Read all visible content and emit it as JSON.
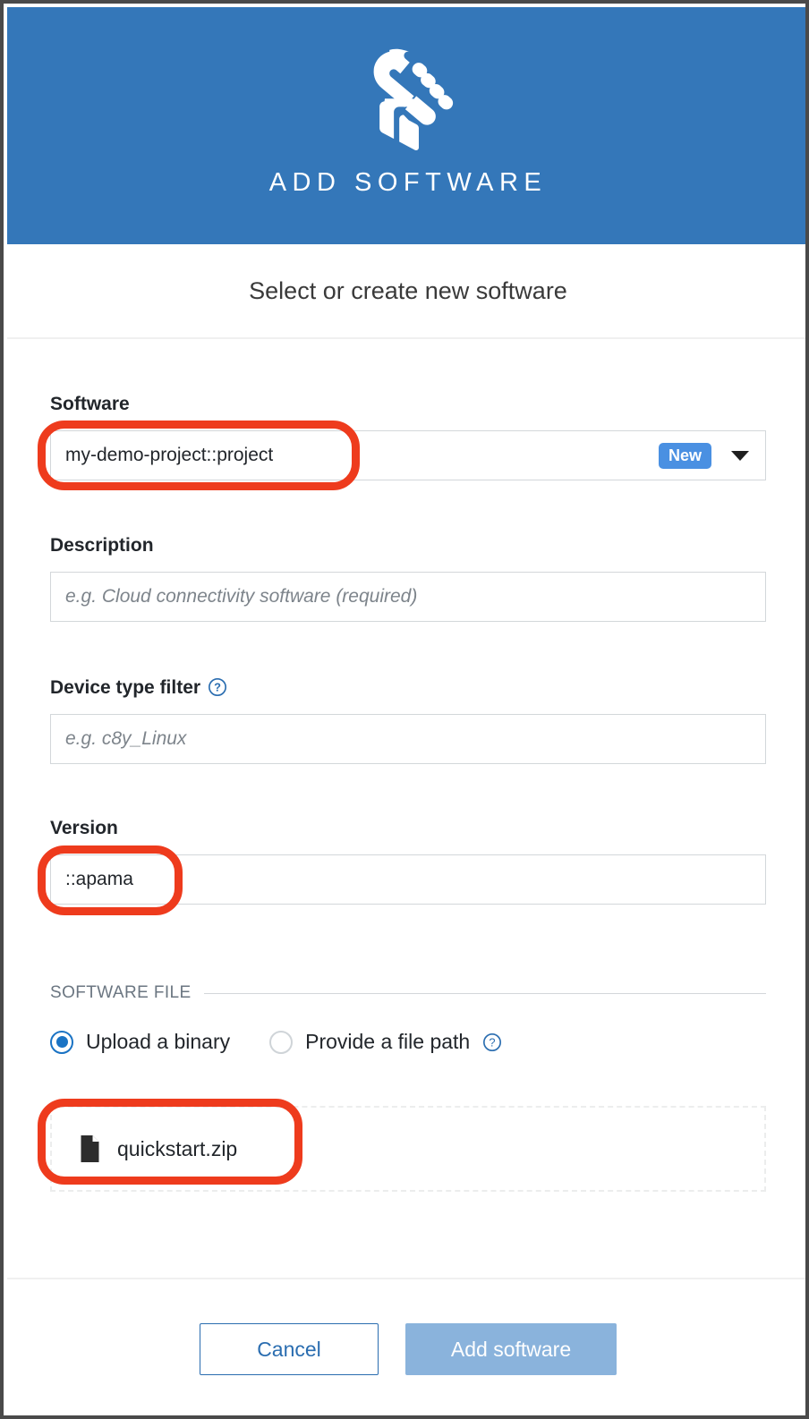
{
  "header": {
    "title": "ADD SOFTWARE",
    "icon": "wrench-screwdriver-icon",
    "background_color": "#3477b9"
  },
  "subtitle": "Select or create new software",
  "form": {
    "software": {
      "label": "Software",
      "value": "my-demo-project::project",
      "badge": "New",
      "dropdown_icon": "chevron-down-icon"
    },
    "description": {
      "label": "Description",
      "value": "",
      "placeholder": "e.g. Cloud connectivity software (required)"
    },
    "device_type_filter": {
      "label": "Device type filter",
      "value": "",
      "placeholder": "e.g. c8y_Linux",
      "help_icon": "help-circle-icon"
    },
    "version": {
      "label": "Version",
      "value": "::apama"
    }
  },
  "software_file": {
    "legend": "SOFTWARE FILE",
    "options": [
      {
        "label": "Upload a binary",
        "selected": true
      },
      {
        "label": "Provide a file path",
        "selected": false,
        "help_icon": "help-circle-icon"
      }
    ],
    "dropzone": {
      "file_name": "quickstart.zip",
      "file_icon": "document-icon"
    }
  },
  "footer": {
    "cancel_label": "Cancel",
    "submit_label": "Add software"
  },
  "colors": {
    "header_blue": "#3477b9",
    "badge_blue": "#4a90e2",
    "link_blue": "#2a6db0",
    "primary_disabled": "#8ab3dc",
    "annotation_red": "#ee3b1d",
    "radio_selected": "#1a73c4"
  }
}
